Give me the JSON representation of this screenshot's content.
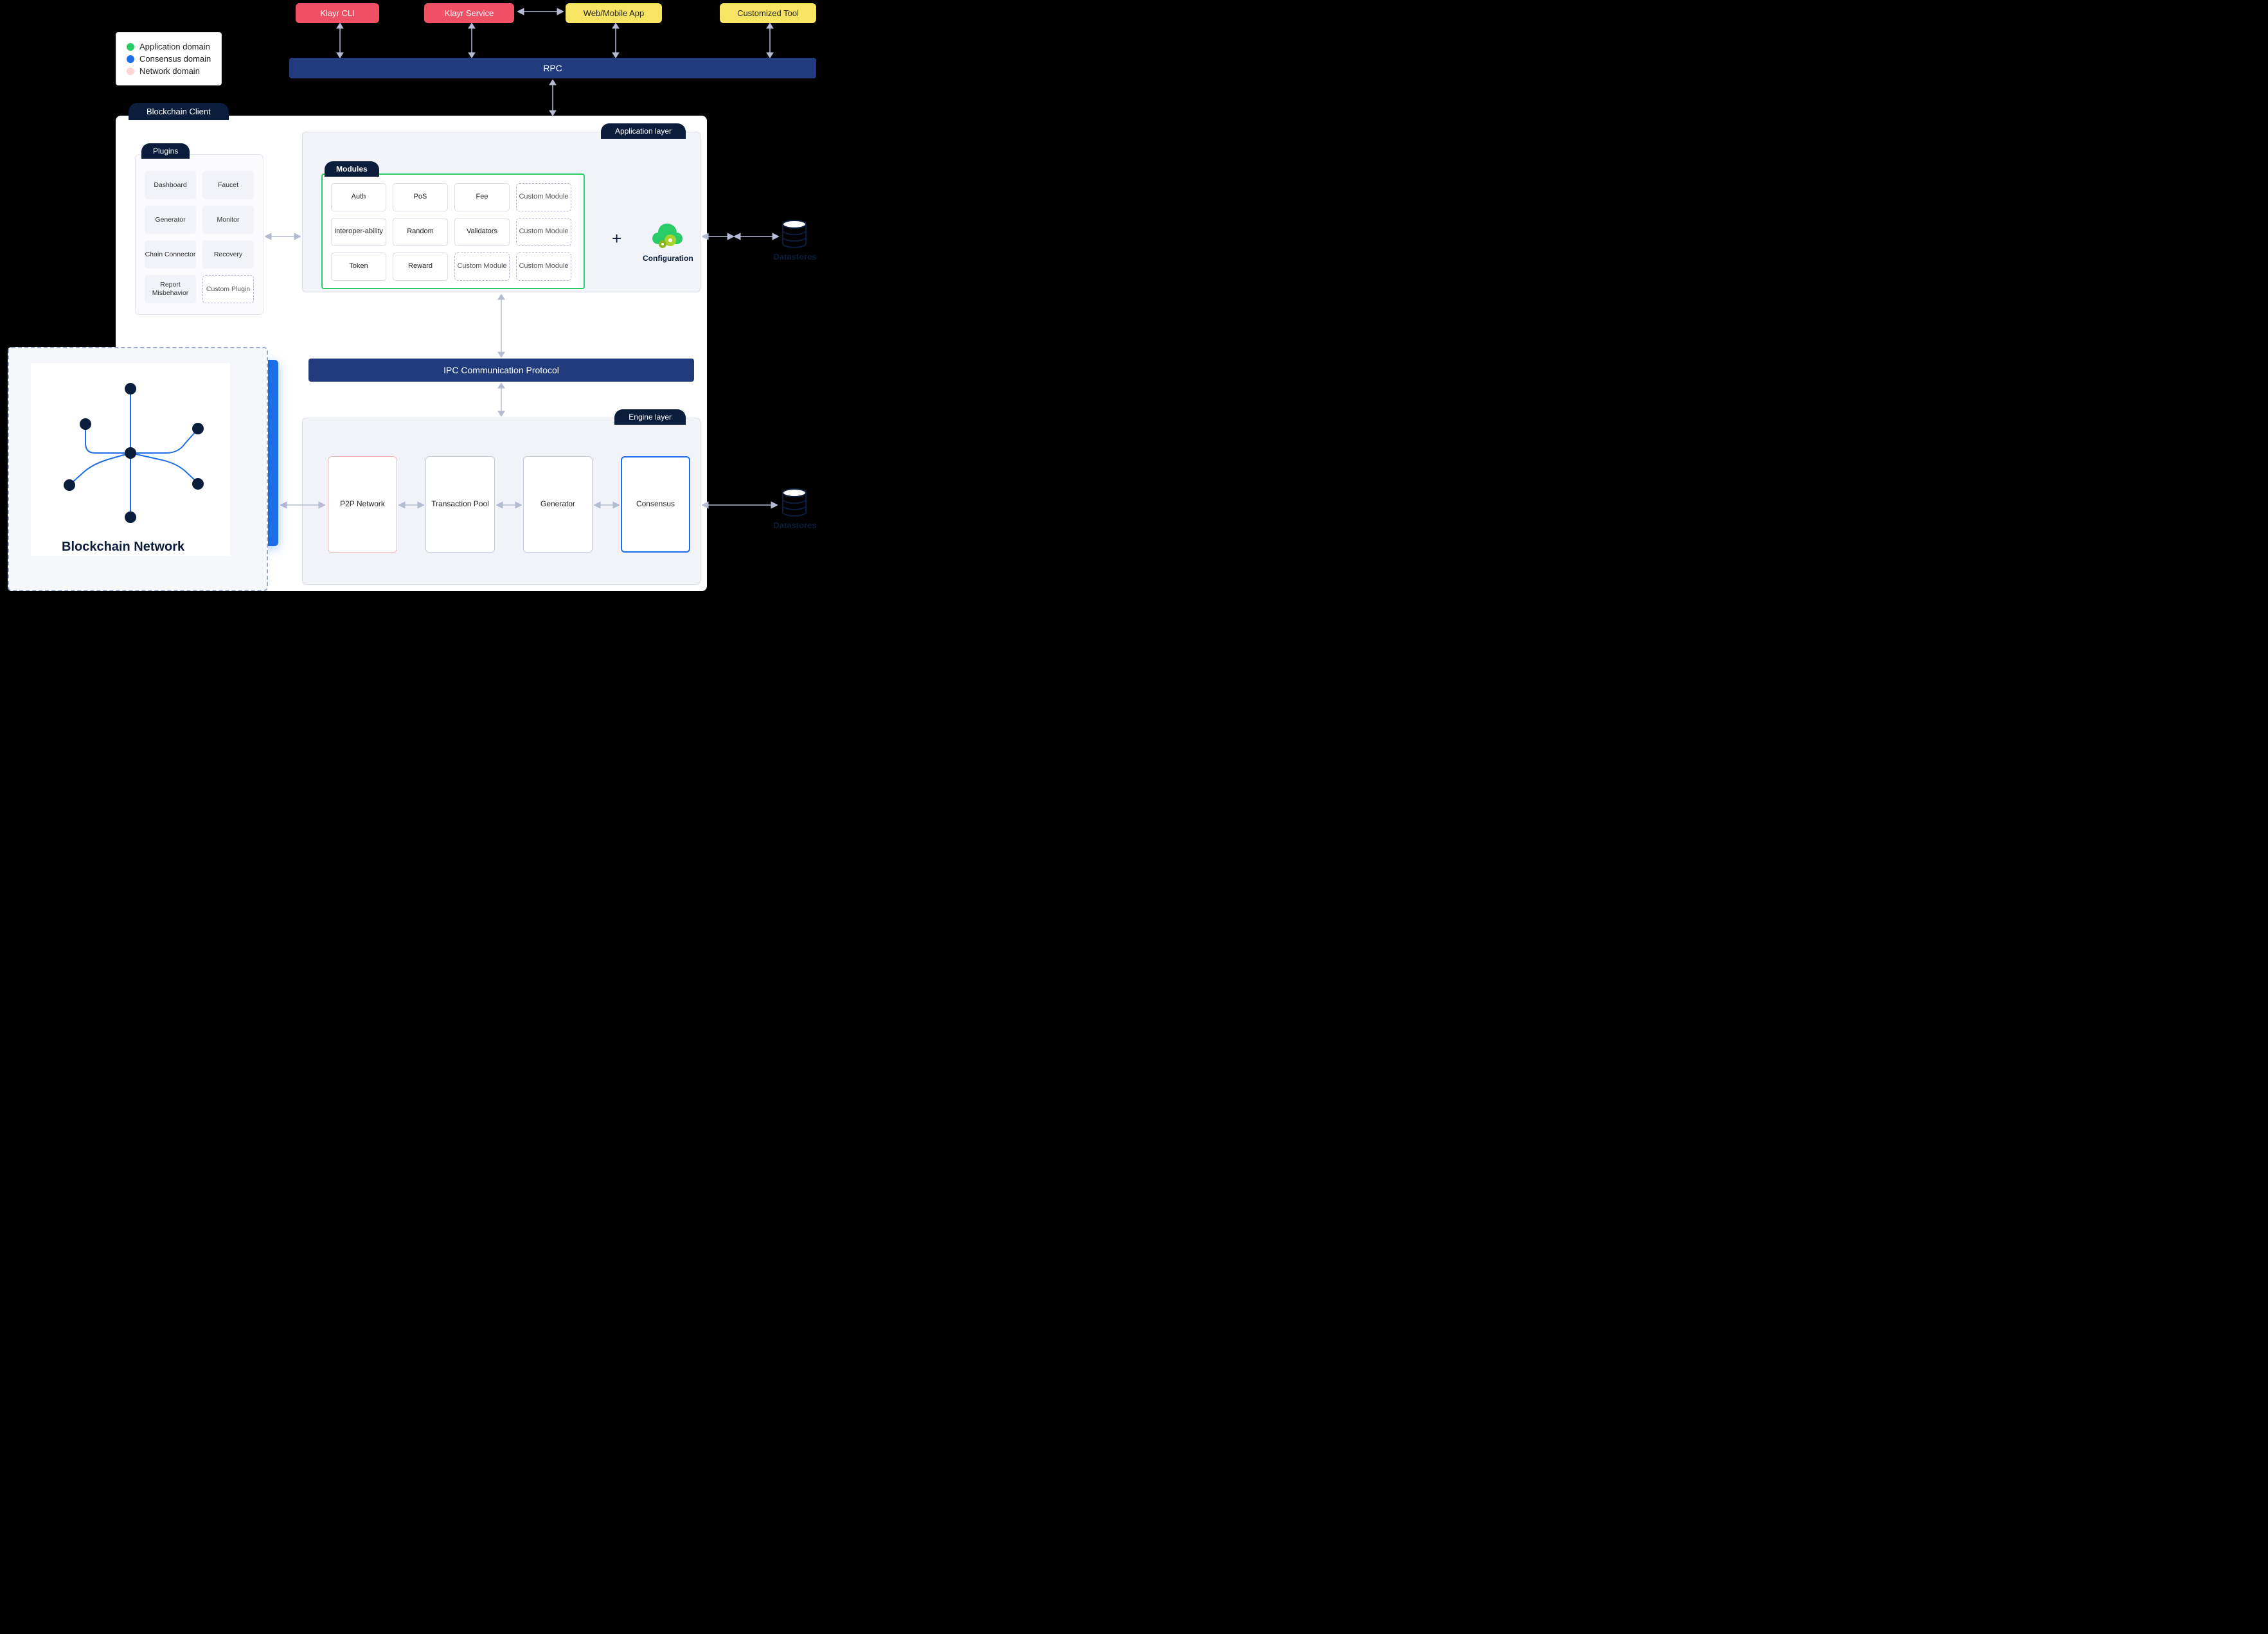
{
  "legend": {
    "app": "Application domain",
    "consensus": "Consensus domain",
    "network": "Network domain"
  },
  "top": {
    "cli": "Klayr CLI",
    "service": "Klayr Service",
    "webapp": "Web/Mobile App",
    "tool": "Customized Tool"
  },
  "rpc": "RPC",
  "client_title": "Blockchain Client",
  "app_layer": "Application layer",
  "engine_layer": "Engine layer",
  "modules_label": "Modules",
  "modules": {
    "r0c0": "Auth",
    "r0c1": "PoS",
    "r0c2": "Fee",
    "r0c3": "Custom Module",
    "r1c0": "Interoper-ability",
    "r1c1": "Random",
    "r1c2": "Validators",
    "r1c3": "Custom Module",
    "r2c0": "Token",
    "r2c1": "Reward",
    "r2c2": "Custom Module",
    "r2c3": "Custom Module"
  },
  "config": "Configuration",
  "plugins_label": "Plugins",
  "plugins": {
    "p0": "Dashboard",
    "p1": "Faucet",
    "p2": "Generator",
    "p3": "Monitor",
    "p4": "Chain Connector",
    "p5": "Recovery",
    "p6": "Report Misbehavior",
    "p7": "Custom Plugin"
  },
  "ipc": "IPC Communication Protocol",
  "engine": {
    "p2p": "P2P Network",
    "pool": "Transaction Pool",
    "gen": "Generator",
    "cons": "Consensus"
  },
  "network_title": "Blockchain Network",
  "datastores": "Datastores"
}
